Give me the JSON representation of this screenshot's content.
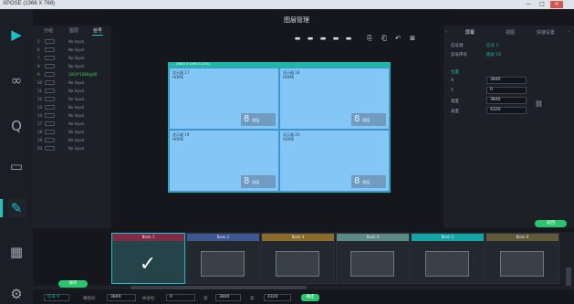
{
  "window": {
    "title": "XPOSE (1366 X 768)",
    "minimize": "—",
    "maximize": "□",
    "close": "✕"
  },
  "nav": {
    "items": [
      "▶",
      "∞",
      "Q",
      "▭",
      "✎",
      "▦",
      "⚙"
    ]
  },
  "list": {
    "tabs": [
      "分组",
      "图层",
      "信号"
    ],
    "rows": [
      {
        "num": "5",
        "label": "No Input"
      },
      {
        "num": "6",
        "label": "No Input"
      },
      {
        "num": "7",
        "label": "No Input"
      },
      {
        "num": "8",
        "label": "No Input"
      },
      {
        "num": "9",
        "label": "1920*1080@60"
      },
      {
        "num": "10",
        "label": "No Input"
      },
      {
        "num": "11",
        "label": "No Input"
      },
      {
        "num": "12",
        "label": "No Input"
      },
      {
        "num": "13",
        "label": "No Input"
      },
      {
        "num": "14",
        "label": "No Input"
      },
      {
        "num": "17",
        "label": "No Input"
      },
      {
        "num": "18",
        "label": "No Input"
      },
      {
        "num": "19",
        "label": "No Input"
      },
      {
        "num": "20",
        "label": "No Input"
      }
    ]
  },
  "center": {
    "title": "图层管理",
    "toolbar": [
      "▬",
      "▬",
      "▬",
      "▬",
      "▬",
      "⎘",
      "⎗",
      "↶",
      "⊠"
    ],
    "canvas_header": "… (3840 X 2160 0.22%)",
    "screens": [
      {
        "name": "显示器 17",
        "src": "HOME",
        "num": "8",
        "unit": "图层"
      },
      {
        "name": "显示器 18",
        "src": "HOME",
        "num": "8",
        "unit": "图层"
      },
      {
        "name": "显示器 19",
        "src": "HOME",
        "num": "8",
        "unit": "图层"
      },
      {
        "name": "显示器 20",
        "src": "HOME",
        "num": "8",
        "unit": "图层"
      }
    ]
  },
  "props": {
    "back": "‹",
    "forward": "›",
    "tabs": [
      "屏幕",
      "视图",
      "快速设置"
    ],
    "signal_label": "信号源",
    "signal_value": "信号 5",
    "sigid_label": "信号序号",
    "sigid_value": "图层 16",
    "position_label": "位置",
    "x_label": "X",
    "x_value": "3840",
    "y_label": "Y",
    "y_value": "0",
    "w_label": "宽度",
    "w_value": "3840",
    "h_label": "高度",
    "h_value": "4320",
    "link_icon": "⛓",
    "reset": "返回"
  },
  "banks": [
    {
      "name": "Bank 1",
      "color": "#7e2d46",
      "active": true,
      "check": "✓"
    },
    {
      "name": "Bank 2",
      "color": "#3f5790",
      "active": false
    },
    {
      "name": "Bank 3",
      "color": "#8a6b2c",
      "active": false
    },
    {
      "name": "Bank 4",
      "color": "#5d8a86",
      "active": false
    },
    {
      "name": "Bank 5",
      "color": "#12a6a6",
      "active": false
    },
    {
      "name": "Bank 6",
      "color": "#605a3a",
      "active": false
    }
  ],
  "footer": {
    "save": "保存",
    "signal_label": "信号 6",
    "x_label": "横坐标",
    "x_value": "3840",
    "y_label": "纵坐标",
    "y_value": "0",
    "w_label": "宽",
    "w_value": "3840",
    "h_label": "高",
    "h_value": "4320",
    "apply": "确定"
  }
}
